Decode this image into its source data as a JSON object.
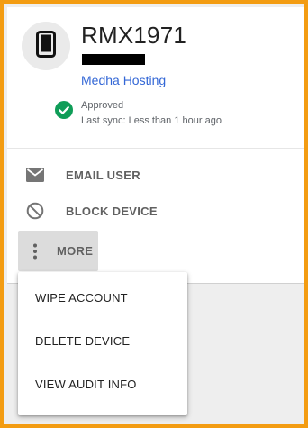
{
  "device": {
    "name": "RMX1971",
    "organization": "Medha Hosting",
    "status": "Approved",
    "last_sync": "Last sync: Less than 1 hour ago",
    "icon": "smartphone-icon",
    "status_icon": "check-circle-icon",
    "status_color": "#0f9d58"
  },
  "actions": {
    "email_user": "EMAIL USER",
    "block_device": "BLOCK DEVICE",
    "more": "MORE"
  },
  "menu": {
    "items": [
      "WIPE ACCOUNT",
      "DELETE DEVICE",
      "VIEW AUDIT INFO"
    ]
  },
  "colors": {
    "frame_border": "#f39c12",
    "link": "#3367d6",
    "action_text": "#616161"
  }
}
